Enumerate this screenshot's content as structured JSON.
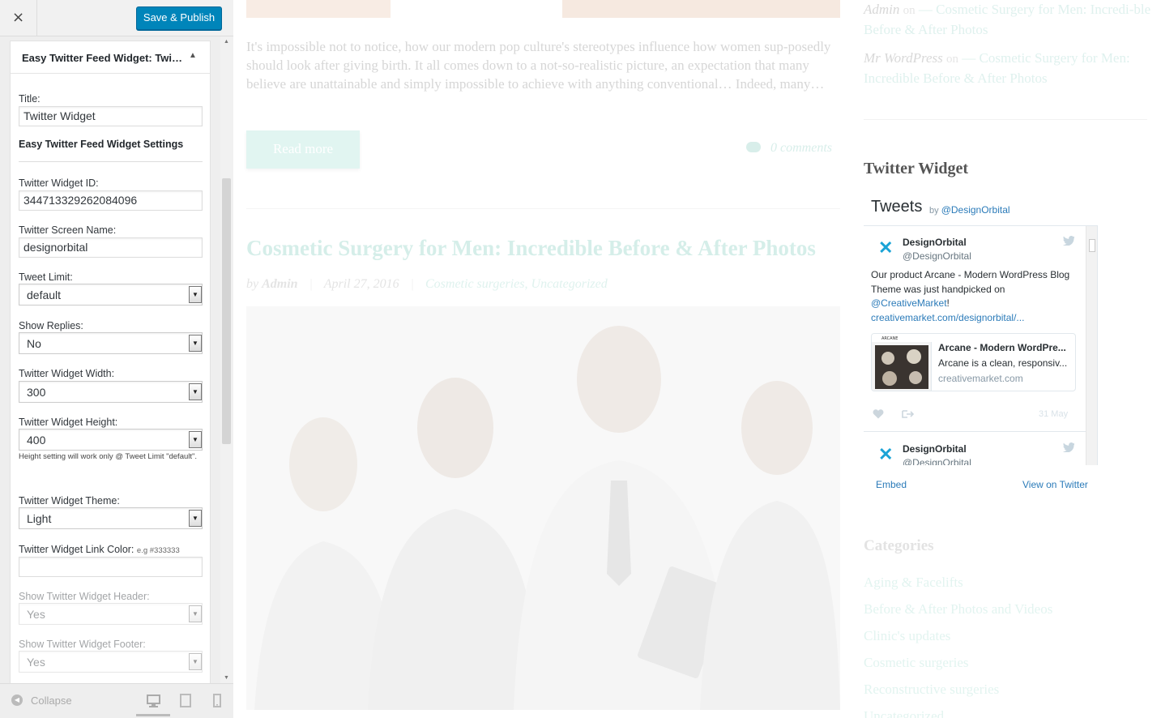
{
  "customizer": {
    "close_label": "×",
    "save_label": "Save & Publish",
    "widget_title": "Easy Twitter Feed Widget: Twi…",
    "widget_toggle": "▲",
    "fields": {
      "title_label": "Title:",
      "title_value": "Twitter Widget",
      "section_title": "Easy Twitter Feed Widget Settings",
      "id_label": "Twitter Widget ID:",
      "id_value": "344713329262084096",
      "screen_name_label": "Twitter Screen Name:",
      "screen_name_value": "designorbital",
      "tweet_limit_label": "Tweet Limit:",
      "tweet_limit_value": "default",
      "show_replies_label": "Show Replies:",
      "show_replies_value": "No",
      "width_label": "Twitter Widget Width:",
      "width_value": "300",
      "height_label": "Twitter Widget Height:",
      "height_value": "400",
      "height_note": "Height setting will work only @ Tweet Limit \"default\".",
      "theme_label": "Twitter Widget Theme:",
      "theme_value": "Light",
      "link_color_label": "Twitter Widget Link Color:",
      "link_color_hint": "e.g #333333",
      "link_color_value": "",
      "show_header_label": "Show Twitter Widget Header:",
      "show_header_value": "Yes",
      "show_footer_label": "Show Twitter Widget Footer:",
      "show_footer_value": "Yes"
    },
    "footer": {
      "collapse_label": "Collapse",
      "devices": [
        "desktop-icon",
        "tablet-icon",
        "mobile-icon"
      ]
    },
    "accent_color": "#0085ba"
  },
  "preview": {
    "excerpt": "It's impossible not to notice, how our modern pop culture's stereotypes influence how women sup-posedly should look after giving birth. It all comes down to a not-so-realistic picture, an expectation that many believe are unattainable and simply impossible to achieve with anything conventional… Indeed, many…",
    "read_more": "Read more",
    "comments": "0 comments",
    "post_title": "Cosmetic Surgery for Men: Incredible Before & After Photos",
    "post_meta": {
      "by": "by",
      "author": "Admin",
      "date": "April 27, 2016",
      "categories": "Cosmetic surgeries, Uncategorized"
    },
    "recent_comments": [
      {
        "author": "Admin",
        "on": "on",
        "link": "— Cosmetic Surgery for Men: Incredi-ble Before & After Photos"
      },
      {
        "author": "Mr WordPress",
        "on": "on",
        "link": "— Cosmetic Surgery for Men: Incredible Before & After Photos"
      }
    ],
    "widget_heading": "Twitter Widget",
    "twitter": {
      "header": "Tweets",
      "by": "by",
      "by_handle": "@DesignOrbital",
      "tweet1": {
        "name": "DesignOrbital",
        "handle": "@DesignOrbital",
        "text_a": "Our product Arcane - Modern WordPress Blog Theme was just handpicked on ",
        "mention": "@CreativeMarket",
        "text_b": "!",
        "url": "creativemarket.com/designorbital/...",
        "card_title": "Arcane - Modern WordPre...",
        "card_desc": "Arcane is a clean, responsiv...",
        "card_domain": "creativemarket.com",
        "date": "31 May"
      },
      "tweet2": {
        "name": "DesignOrbital",
        "handle": "@DesignOrbital"
      },
      "footer_embed": "Embed",
      "footer_view": "View on Twitter"
    },
    "categories_heading": "Categories",
    "categories": [
      "Aging & Facelifts",
      "Before & After Photos and Videos",
      "Clinic's updates",
      "Cosmetic surgeries",
      "Reconstructive surgeries",
      "Uncategorized"
    ]
  }
}
